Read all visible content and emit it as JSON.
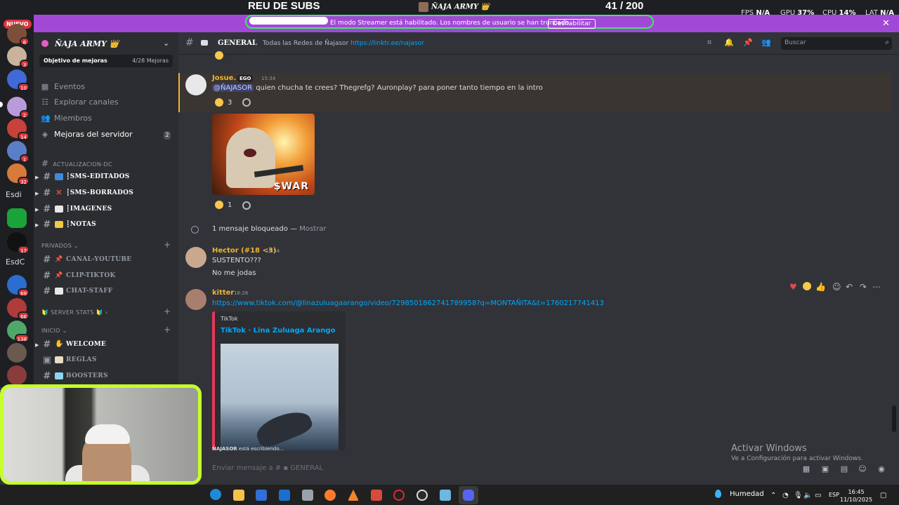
{
  "overlay": {
    "subs_label": "REU DE SUBS",
    "subs_user": "ÑAJA ARMY 👑",
    "subs_count": "41  / 200",
    "stats": [
      {
        "label": "FPS",
        "value": "N/A"
      },
      {
        "label": "GPU",
        "value": "37%"
      },
      {
        "label": "CPU",
        "value": "14%"
      },
      {
        "label": "LAT",
        "value": "N/A"
      }
    ]
  },
  "streamer_banner": {
    "text": "El modo Streamer está habilitado. Los nombres de usuario se han truncado.",
    "button": "Deshabilitar"
  },
  "server_rail": {
    "nuevo": "NUEVO",
    "badges": [
      "6",
      "3",
      "10",
      "2",
      "14",
      "1",
      "32",
      "17",
      "69",
      "66",
      "138"
    ],
    "text_servers": [
      "Esdi",
      "EsdC"
    ]
  },
  "sidebar": {
    "server_name": "ÑAJA ARMY 👑",
    "goal_label": "Objetivo de mejoras",
    "goal_count": "4/28 Mejoras",
    "items": [
      {
        "label": "Eventos",
        "icon": "calendar-icon"
      },
      {
        "label": "Explorar canales",
        "icon": "compass-icon"
      },
      {
        "label": "Miembros",
        "icon": "members-icon"
      },
      {
        "label": "Mejoras del servidor",
        "icon": "boost-icon",
        "badge": "2"
      }
    ],
    "categories": {
      "actualizacion": "ACTUALIZACION-DC",
      "privados": "PRIVADOS",
      "server_stats": "🔰 SERVER STATS 🔰",
      "inicio": "INICIO"
    },
    "channels_actualizacion": [
      "┋SMS-EDITADOS",
      "┋SMS-BORRADOS",
      "┋IMAGENES",
      "┋NOTAS"
    ],
    "channels_privados": [
      "CANAL-YOUTUBE",
      "CLIP-TIKTOK",
      "CHAT-STAFF"
    ],
    "channels_inicio": [
      "WELCOME",
      "REGLAS",
      "BOOSTERS"
    ]
  },
  "header": {
    "channel": "GENERAL",
    "topic": "Todas las Redes de Ñajasor",
    "topic_link": "https://linktr.ee/najasor",
    "search_placeholder": "Buscar"
  },
  "messages": {
    "josue": {
      "author": "Josue.",
      "tag": "EGO",
      "time": "15:34",
      "mention": "@ÑAJASOR",
      "text": "quien chucha te crees? Thegrefg? Auronplay? para poner tanto tiempo en la intro",
      "reaction_count": "3"
    },
    "image": {
      "caption": "$WAR",
      "reaction_count": "1"
    },
    "blocked": {
      "text": "1 mensaje bloqueado — ",
      "show": "Mostrar"
    },
    "hector": {
      "author": "Hector (#18 <3)",
      "time": "15:54",
      "line1": "SUSTENTO???",
      "line2": "No me jodas"
    },
    "kitter": {
      "author": "kitter",
      "time": "16:28",
      "link": "https://www.tiktok.com/@linazuluagaarango/video/7298501862741789958?q=MONTAÑITA&t=1760217741413",
      "embed_provider": "TikTok",
      "embed_title": "TikTok · Lina Zuluaga Arango"
    },
    "typing_user": "ÑAJASOR",
    "typing_text": " está escribiendo..."
  },
  "composer": {
    "placeholder_prefix": "Enviar mensaje a #",
    "placeholder_channel": "GENERAL"
  },
  "windows": {
    "activate_title": "Activar Windows",
    "activate_sub": "Ve a Configuración para activar Windows.",
    "weather": "Humedad",
    "lang": "ESP",
    "time": "16:45",
    "date": "11/10/2025"
  },
  "colors": {
    "banner": "#a149d6",
    "webcam_border": "#c6ff2b",
    "link": "#00a8fc",
    "josue": "#f0b232",
    "hector": "#f0b232",
    "kitter": "#f0b232"
  }
}
